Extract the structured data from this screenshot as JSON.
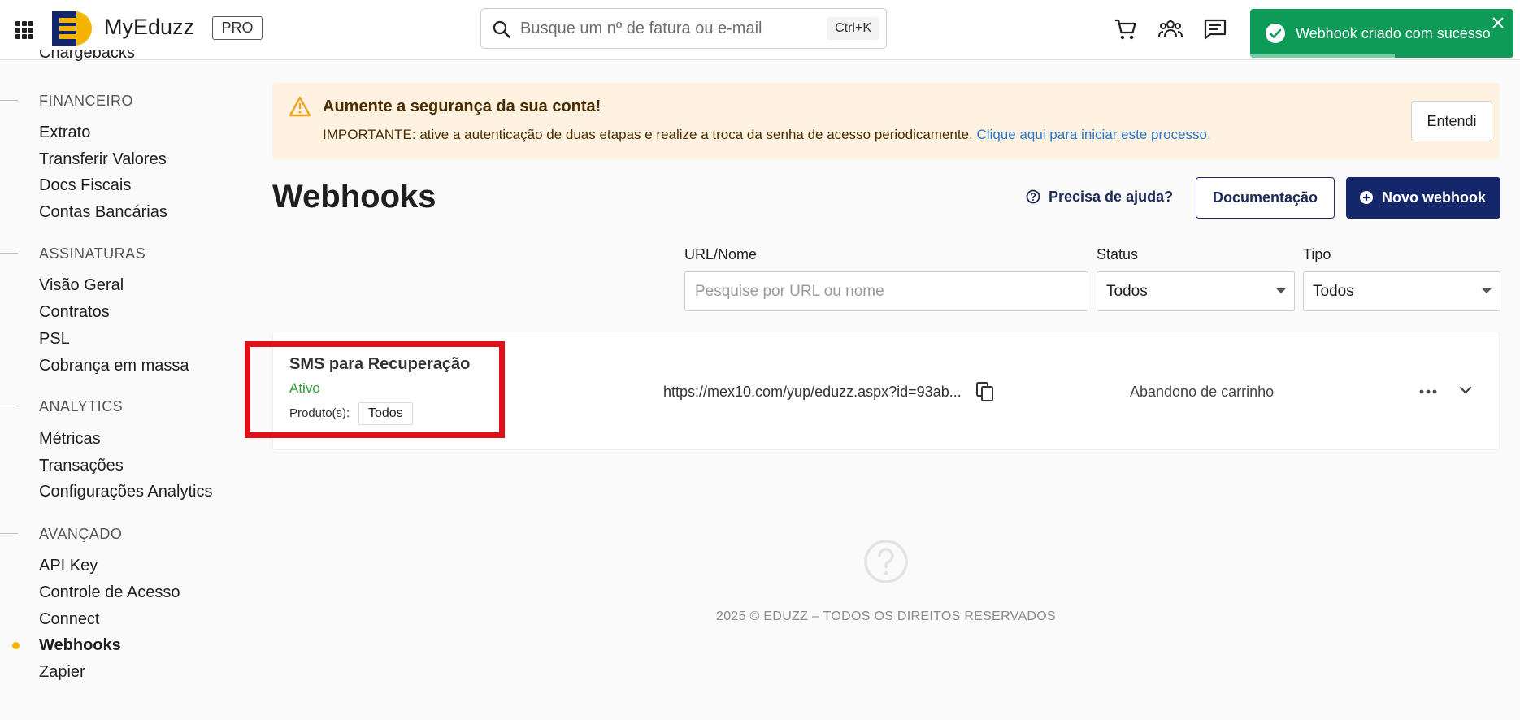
{
  "header": {
    "brand": "MyEduzz",
    "plan_badge": "PRO",
    "search_placeholder": "Busque um nº de fatura ou e-mail",
    "search_shortcut": "Ctrl+K",
    "icons": [
      "apps-icon",
      "cart-icon",
      "users-icon",
      "chat-icon"
    ]
  },
  "toast": {
    "message": "Webhook criado com sucesso",
    "progress": 0.55,
    "color": "#0e9b58"
  },
  "sidebar": {
    "cut_item": "Chargebacks",
    "sections": [
      {
        "title": "FINANCEIRO",
        "items": [
          "Extrato",
          "Transferir Valores",
          "Docs Fiscais",
          "Contas Bancárias"
        ]
      },
      {
        "title": "ASSINATURAS",
        "items": [
          "Visão Geral",
          "Contratos",
          "PSL",
          "Cobrança em massa"
        ]
      },
      {
        "title": "ANALYTICS",
        "items": [
          "Métricas",
          "Transações",
          "Configurações Analytics"
        ]
      },
      {
        "title": "AVANÇADO",
        "items": [
          "API Key",
          "Controle de Acesso",
          "Connect",
          "Webhooks",
          "Zapier"
        ]
      }
    ],
    "active_item": "Webhooks",
    "active_color": "#f5b400"
  },
  "alert": {
    "title": "Aumente a segurança da sua conta!",
    "body": "IMPORTANTE: ative a autenticação de duas etapas e realize a troca da senha de acesso periodicamente.",
    "link": "Clique aqui para iniciar este processo.",
    "button": "Entendi",
    "background": "#fff2e1"
  },
  "page": {
    "title": "Webhooks",
    "help_link": "Precisa de ajuda?",
    "doc_button": "Documentação",
    "new_button": "Novo webhook",
    "primary_color": "#14276b"
  },
  "filters": {
    "url_label": "URL/Nome",
    "url_placeholder": "Pesquise por URL ou nome",
    "status_label": "Status",
    "status_value": "Todos",
    "type_label": "Tipo",
    "type_value": "Todos"
  },
  "webhooks": [
    {
      "name": "SMS para Recuperação",
      "status": "Ativo",
      "products_label": "Produto(s):",
      "products_value": "Todos",
      "url": "https://mex10.com/yup/eduzz.aspx?id=93ab...",
      "type": "Abandono de carrinho"
    }
  ],
  "highlight_color": "#e0101a",
  "footer": {
    "text": "2025 © EDUZZ – TODOS OS DIREITOS RESERVADOS"
  }
}
